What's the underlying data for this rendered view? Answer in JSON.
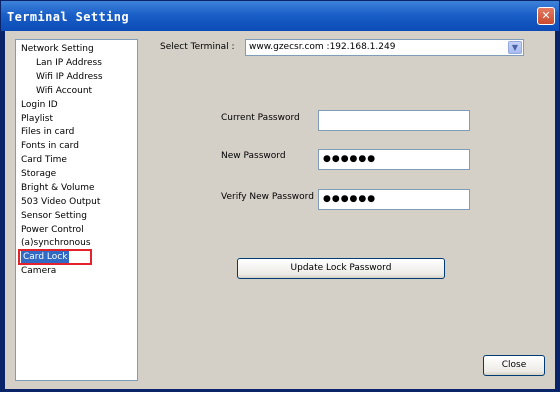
{
  "window": {
    "title": "Terminal Setting",
    "close_glyph": "✕"
  },
  "tree": {
    "items": [
      {
        "label": "Network Setting",
        "level": 0
      },
      {
        "label": "Lan IP Address",
        "level": 1
      },
      {
        "label": "Wifi IP Address",
        "level": 1
      },
      {
        "label": "Wifi Account",
        "level": 1
      },
      {
        "label": "Login ID",
        "level": 0
      },
      {
        "label": "Playlist",
        "level": 0
      },
      {
        "label": "Files in card",
        "level": 0
      },
      {
        "label": "Fonts in card",
        "level": 0
      },
      {
        "label": "Card Time",
        "level": 0
      },
      {
        "label": "Storage",
        "level": 0
      },
      {
        "label": "Bright & Volume",
        "level": 0
      },
      {
        "label": "503 Video Output",
        "level": 0
      },
      {
        "label": "Sensor Setting",
        "level": 0
      },
      {
        "label": "Power Control",
        "level": 0
      },
      {
        "label": "(a)synchronous",
        "level": 0
      },
      {
        "label": "Card Lock",
        "level": 0,
        "selected": true
      },
      {
        "label": "Camera",
        "level": 0
      }
    ]
  },
  "terminal": {
    "label": "Select Terminal :",
    "value": "www.gzecsr.com :192.168.1.249"
  },
  "form": {
    "current_label": "Current Password",
    "current_value": "",
    "new_label": "New Password",
    "new_value": "●●●●●●",
    "verify_label": "Verify New Password",
    "verify_value": "●●●●●●",
    "update_label": "Update Lock Password"
  },
  "footer": {
    "close_label": "Close"
  },
  "colors": {
    "title_bar": "#1a5fc8",
    "selection": "#316ac5",
    "highlight_box": "#e3222b",
    "dialog_bg": "#d4d0c8"
  }
}
